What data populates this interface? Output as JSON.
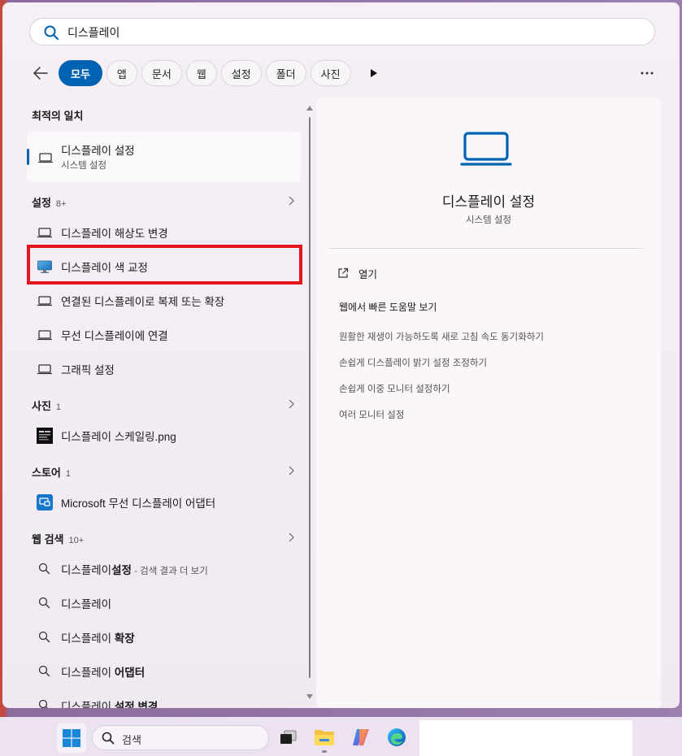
{
  "search": {
    "value": "디스플레이",
    "placeholder": ""
  },
  "filters": [
    {
      "label": "모두",
      "active": true
    },
    {
      "label": "앱"
    },
    {
      "label": "문서"
    },
    {
      "label": "웹"
    },
    {
      "label": "설정"
    },
    {
      "label": "폴더"
    },
    {
      "label": "사진"
    }
  ],
  "best_match": {
    "title": "최적의 일치",
    "item": {
      "label": "디스플레이 설정",
      "sub": "시스템 설정"
    }
  },
  "settings": {
    "title": "설정",
    "count": "8+",
    "items": [
      {
        "label": "디스플레이 해상도 변경"
      },
      {
        "label": "디스플레이 색 교정"
      },
      {
        "label": "연결된 디스플레이로 복제 또는 확장"
      },
      {
        "label": "무선 디스플레이에 연결"
      },
      {
        "label": "그래픽 설정"
      }
    ]
  },
  "photos": {
    "title": "사진",
    "count": "1",
    "items": [
      {
        "label": "디스플레이 스케일링.png"
      }
    ]
  },
  "store": {
    "title": "스토어",
    "count": "1",
    "items": [
      {
        "label": "Microsoft 무선 디스플레이 어댑터"
      }
    ]
  },
  "web": {
    "title": "웹 검색",
    "count": "10+",
    "items": [
      {
        "pre": "디스플레이",
        "bold": "설정",
        "sub": " - 검색 결과 더 보기"
      },
      {
        "pre": "디스플레이",
        "bold": "",
        "sub": ""
      },
      {
        "pre": "디스플레이 ",
        "bold": "확장",
        "sub": ""
      },
      {
        "pre": "디스플레이 ",
        "bold": "어댑터",
        "sub": ""
      },
      {
        "pre": "디스플레이 ",
        "bold": "설정 변경",
        "sub": ""
      }
    ]
  },
  "detail": {
    "title": "디스플레이 설정",
    "subtitle": "시스템 설정",
    "open_label": "열기",
    "help_title": "웹에서 빠른 도움말 보기",
    "links": [
      "원활한 재생이 가능하도록 새로 고침 속도 동기화하기",
      "손쉽게 디스플레이 밝기 설정 조정하기",
      "손쉽게 이중 모니터 설정하기",
      "여러 모니터 설정"
    ]
  },
  "taskbar": {
    "search_label": "검색"
  },
  "icons": {
    "search": "search-icon",
    "back": "back-arrow-icon",
    "play": "play-icon",
    "more": "more-icon",
    "laptop": "laptop-icon",
    "color_monitor": "color-calibration-icon",
    "photo": "image-thumbnail-icon",
    "store_app": "wireless-adapter-app-icon",
    "chevron": "chevron-right-icon",
    "windows": "windows-start-icon",
    "file_explorer": "folder-icon",
    "copilot": "copilot-icon",
    "edge": "edge-browser-icon"
  },
  "colors": {
    "accent": "#0063b1",
    "highlight": "#e3161c"
  }
}
